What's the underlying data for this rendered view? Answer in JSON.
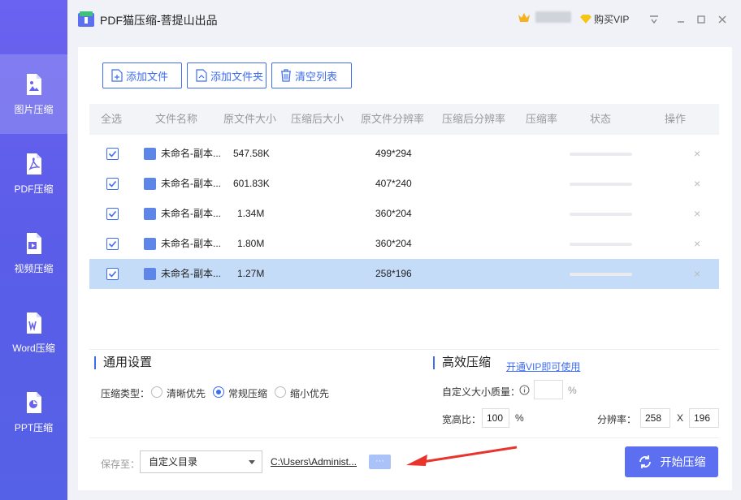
{
  "app": {
    "title": "PDF猫压缩-菩提山出品",
    "buy_vip": "购买VIP"
  },
  "sidebar": {
    "items": [
      {
        "label": "图片压缩",
        "active": true
      },
      {
        "label": "PDF压缩",
        "active": false
      },
      {
        "label": "视频压缩",
        "active": false
      },
      {
        "label": "Word压缩",
        "active": false
      },
      {
        "label": "PPT压缩",
        "active": false
      }
    ]
  },
  "toolbar": {
    "add_file": "添加文件",
    "add_folder": "添加文件夹",
    "clear_list": "清空列表"
  },
  "table": {
    "headers": [
      "全选",
      "文件名称",
      "原文件大小",
      "压缩后大小",
      "原文件分辨率",
      "压缩后分辨率",
      "压缩率",
      "状态",
      "操作"
    ],
    "rows": [
      {
        "name": "未命名-副本...",
        "orig_size": "547.58K",
        "comp_size": "",
        "orig_res": "499*294",
        "comp_res": "",
        "ratio": "",
        "checked": true,
        "selected": false
      },
      {
        "name": "未命名-副本...",
        "orig_size": "601.83K",
        "comp_size": "",
        "orig_res": "407*240",
        "comp_res": "",
        "ratio": "",
        "checked": true,
        "selected": false
      },
      {
        "name": "未命名-副本...",
        "orig_size": "1.34M",
        "comp_size": "",
        "orig_res": "360*204",
        "comp_res": "",
        "ratio": "",
        "checked": true,
        "selected": false
      },
      {
        "name": "未命名-副本...",
        "orig_size": "1.80M",
        "comp_size": "",
        "orig_res": "360*204",
        "comp_res": "",
        "ratio": "",
        "checked": true,
        "selected": false
      },
      {
        "name": "未命名-副本...",
        "orig_size": "1.27M",
        "comp_size": "",
        "orig_res": "258*196",
        "comp_res": "",
        "ratio": "",
        "checked": true,
        "selected": true
      }
    ],
    "delete_glyph": "×"
  },
  "general": {
    "title": "通用设置",
    "type_label": "压缩类型：",
    "options": [
      "清晰优先",
      "常规压缩",
      "缩小优先"
    ],
    "selected_option": "常规压缩"
  },
  "advanced": {
    "title": "高效压缩",
    "vip_link": "开通VIP即可使用",
    "quality_label": "自定义大小质量：",
    "quality_value": "",
    "quality_unit": "%",
    "ratio_label": "宽高比：",
    "ratio_value": "100",
    "ratio_unit": "%",
    "res_label": "分辨率：",
    "res_width": "258",
    "res_sep": "X",
    "res_height": "196"
  },
  "footer": {
    "save_label": "保存至：",
    "save_option": "自定义目录",
    "path": "C:\\Users\\Administ...",
    "more": "···",
    "start": "开始压缩"
  },
  "colors": {
    "accent": "#3e6df0",
    "sidebar": "#5a5de8",
    "selected_row": "#c5dcf8",
    "start_button": "#5b6ff0"
  }
}
